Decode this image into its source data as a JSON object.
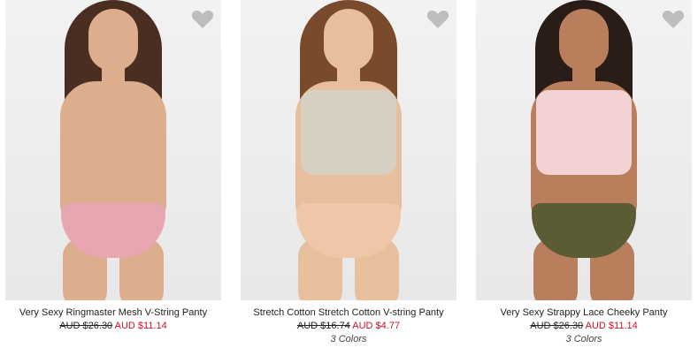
{
  "products": [
    {
      "name": "Very Sexy Ringmaster Mesh V-String Panty",
      "was_price": "AUD $26.30",
      "sale_price": "AUD $11.14",
      "colors": "",
      "swatch": {
        "skin": "#dcae8e",
        "hair": "#4a2e22",
        "top": "",
        "brief": "#e7a6b0"
      }
    },
    {
      "name": "Stretch Cotton Stretch Cotton V-string Panty",
      "was_price": "AUD $16.74",
      "sale_price": "AUD $4.77",
      "colors": "3 Colors",
      "swatch": {
        "skin": "#e8bf9d",
        "hair": "#7a4a2c",
        "top": "#d8cfc3",
        "brief": "#efc7a8"
      }
    },
    {
      "name": "Very Sexy Strappy Lace Cheeky Panty",
      "was_price": "AUD $26.30",
      "sale_price": "AUD $11.14",
      "colors": "3 Colors",
      "swatch": {
        "skin": "#b97f5c",
        "hair": "#2a1c16",
        "top": "#f2d2d2",
        "brief": "#5b5b34"
      }
    }
  ],
  "theme": {
    "sale_color": "#c8102e",
    "heart_color": "#bdbdbd"
  }
}
